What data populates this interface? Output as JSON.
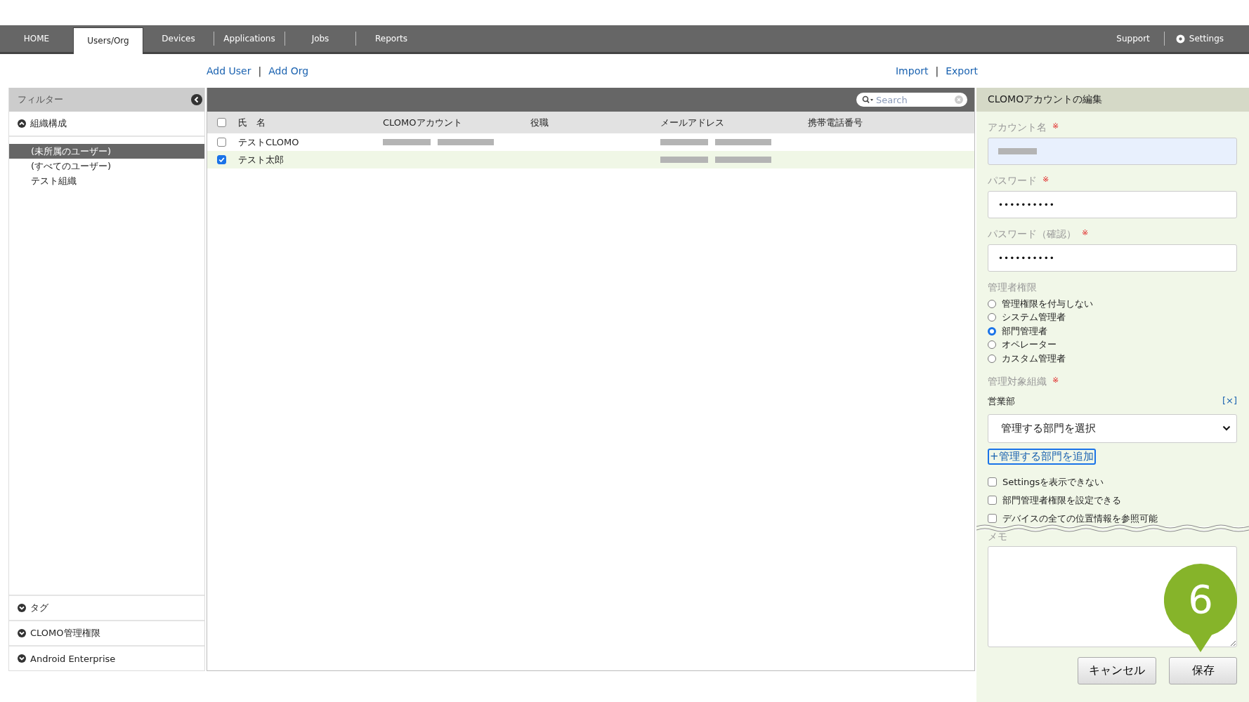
{
  "nav": {
    "tabs": [
      {
        "label": "HOME",
        "selected": false
      },
      {
        "label": "Users/Org",
        "selected": true
      },
      {
        "label": "Devices",
        "selected": false
      },
      {
        "label": "Applications",
        "selected": false
      },
      {
        "label": "Jobs",
        "selected": false
      },
      {
        "label": "Reports",
        "selected": false
      }
    ],
    "right_links": [
      {
        "label": "Support",
        "kind": "plain"
      },
      {
        "label": "Settings",
        "kind": "gear"
      }
    ]
  },
  "actions_left": [
    "Add User",
    "|",
    "Add Org"
  ],
  "actions_right": [
    "Import",
    "|",
    "Export"
  ],
  "filter": {
    "title": "フィルター",
    "sections_top": [
      {
        "label": "組織構成",
        "expanded": true
      }
    ],
    "items": [
      {
        "label": "(未所属のユーザー)",
        "selected": true
      },
      {
        "label": "(すべてのユーザー)",
        "selected": false
      },
      {
        "label": "テスト組織",
        "selected": false
      }
    ],
    "sections_bottom": [
      {
        "label": "タグ",
        "expanded": false
      },
      {
        "label": "CLOMO管理権限",
        "expanded": false
      },
      {
        "label": "Android Enterprise",
        "expanded": false
      }
    ]
  },
  "table": {
    "search": {
      "placeholder": "Search"
    },
    "columns": [
      "氏　名",
      "CLOMOアカウント",
      "役職",
      "メールアドレス",
      "携帯電話番号"
    ],
    "select_all": {
      "checked": false
    },
    "rows": [
      {
        "name": "テストCLOMO",
        "checked": false,
        "account_blurred": true,
        "email_blurred": true
      },
      {
        "name": "テスト太郎",
        "checked": true,
        "account_blurred": false,
        "email_blurred": true
      }
    ]
  },
  "edit_panel": {
    "title": "CLOMOアカウントの編集",
    "required_mark": "※",
    "account": {
      "label": "アカウント名",
      "required": true
    },
    "password": {
      "label": "パスワード",
      "required": true,
      "value": "••••••••••"
    },
    "password_confirm": {
      "label": "パスワード（確認）",
      "required": true,
      "value": "••••••••••"
    },
    "admin_role": {
      "label": "管理者権限",
      "options": [
        {
          "label": "管理権限を付与しない",
          "selected": false
        },
        {
          "label": "システム管理者",
          "selected": false
        },
        {
          "label": "部門管理者",
          "selected": true
        },
        {
          "label": "オペレーター",
          "selected": false
        },
        {
          "label": "カスタム管理者",
          "selected": false
        }
      ]
    },
    "managed_org": {
      "label": "管理対象組織",
      "required": true,
      "current": "営業部",
      "remove": "[×]",
      "select": "管理する部門を選択",
      "add_link": "+管理する部門を追加"
    },
    "permissions": [
      {
        "label": "Settingsを表示できない",
        "checked": false
      },
      {
        "label": "部門管理者権限を設定できる",
        "checked": false
      },
      {
        "label": "デバイスの全ての位置情報を参照可能",
        "checked": false
      }
    ],
    "memo": {
      "label": "メモ"
    },
    "buttons": [
      "キャンセル",
      "保存"
    ]
  },
  "callout": {
    "label": "6"
  }
}
